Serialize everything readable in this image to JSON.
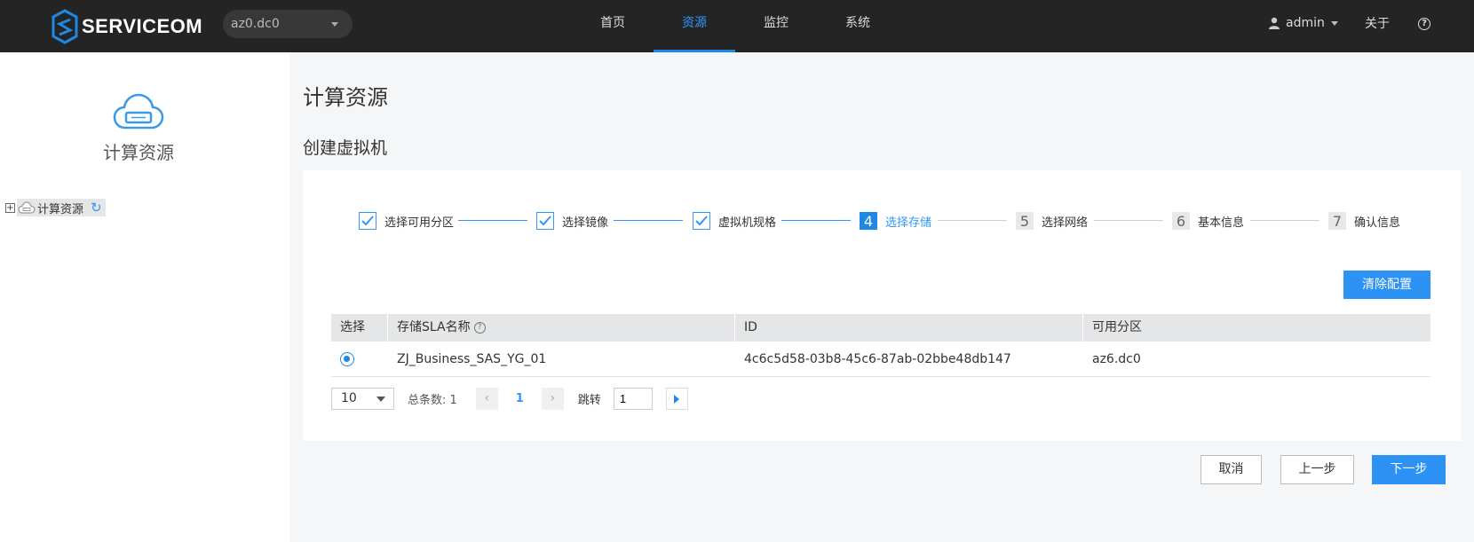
{
  "header": {
    "logo_text": "SERVICEOM",
    "az_select": "az0.dc0",
    "nav": [
      {
        "label": "首页",
        "active": false
      },
      {
        "label": "资源",
        "active": true
      },
      {
        "label": "监控",
        "active": false
      },
      {
        "label": "系统",
        "active": false
      }
    ],
    "user": "admin",
    "about": "关于",
    "help": "?"
  },
  "sidebar": {
    "title": "计算资源",
    "tree": {
      "expand": "+",
      "label": "计算资源",
      "refresh": "↻"
    }
  },
  "main": {
    "page_title": "计算资源",
    "sub_title": "创建虚拟机",
    "steps": [
      {
        "num": "",
        "label": "选择可用分区",
        "state": "done"
      },
      {
        "num": "",
        "label": "选择镜像",
        "state": "done"
      },
      {
        "num": "",
        "label": "虚拟机规格",
        "state": "done"
      },
      {
        "num": "4",
        "label": "选择存储",
        "state": "current"
      },
      {
        "num": "5",
        "label": "选择网络",
        "state": "todo"
      },
      {
        "num": "6",
        "label": "基本信息",
        "state": "todo"
      },
      {
        "num": "7",
        "label": "确认信息",
        "state": "todo"
      }
    ],
    "clear_button": "清除配置",
    "table": {
      "headers": [
        "选择",
        "存储SLA名称",
        "ID",
        "可用分区"
      ],
      "help_mark": "?",
      "rows": [
        {
          "selected": true,
          "name": "ZJ_Business_SAS_YG_01",
          "id": "4c6c5d58-03b8-45c6-87ab-02bbe48db147",
          "az": "az6.dc0"
        }
      ]
    },
    "pager": {
      "page_size": "10",
      "total": "总条数: 1",
      "prev": "‹",
      "current_page": "1",
      "next": "›",
      "jump_label": "跳转",
      "jump_value": "1"
    },
    "buttons": {
      "cancel": "取消",
      "prev": "上一步",
      "next": "下一步"
    }
  },
  "colors": {
    "accent": "#1e88e5",
    "topbar": "#242424",
    "sidebar_bg": "#ffffff",
    "page_bg": "#f5f6f7"
  }
}
